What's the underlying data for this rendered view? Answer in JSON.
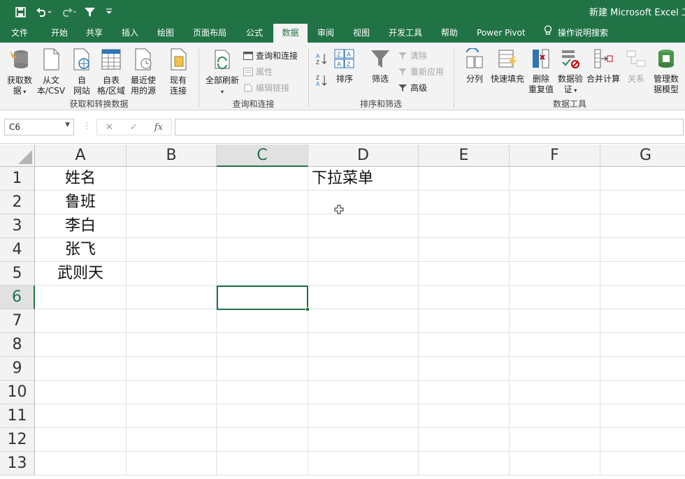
{
  "titlebar": {
    "title": "新建 Microsoft Excel 工作表",
    "save_icon": "save-icon",
    "undo_icon": "undo-icon",
    "redo_icon": "redo-icon",
    "filter_icon": "filter-icon",
    "customize_icon": "customize-quick-access-icon",
    "bg": "#217346"
  },
  "tabs": [
    {
      "label": "文件"
    },
    {
      "label": "开始"
    },
    {
      "label": "共享"
    },
    {
      "label": "插入"
    },
    {
      "label": "绘图"
    },
    {
      "label": "页面布局"
    },
    {
      "label": "公式"
    },
    {
      "label": "数据",
      "active": true
    },
    {
      "label": "审阅"
    },
    {
      "label": "视图"
    },
    {
      "label": "开发工具"
    },
    {
      "label": "帮助"
    },
    {
      "label": "Power Pivot"
    },
    {
      "label": "操作说明搜索",
      "icon": "lightbulb-icon"
    }
  ],
  "ribbon": {
    "get_transform": {
      "group_label": "获取和转换数据",
      "get_data": "获取数\n据",
      "from_text": "从文\n本/CSV",
      "from_web": "自\n网站",
      "from_table": "自表\n格/区域",
      "recent_sources": "最近使\n用的源",
      "existing": "现有\n连接"
    },
    "queries": {
      "group_label": "查询和连接",
      "refresh_all": "全部刷新",
      "queries_conn": "查询和连接",
      "properties": "属性",
      "edit_links": "编辑链接"
    },
    "sort_filter": {
      "group_label": "排序和筛选",
      "sort": "排序",
      "filter": "筛选",
      "clear": "清除",
      "reapply": "重新应用",
      "advanced": "高级"
    },
    "data_tools": {
      "group_label": "数据工具",
      "text_to_columns": "分列",
      "flash_fill": "快速填充",
      "remove_dup": "删除\n重复值",
      "validation": "数据验\n证",
      "consolidate": "合并计算",
      "relations": "关系",
      "data_model": "管理数\n据模型"
    }
  },
  "formula_bar": {
    "name_box": "C6",
    "cancel": "✕",
    "enter": "✓",
    "fx": "fx",
    "content": ""
  },
  "grid": {
    "columns": [
      "A",
      "B",
      "C",
      "D",
      "E",
      "F",
      "G"
    ],
    "selected_col": "C",
    "rows": [
      "1",
      "2",
      "3",
      "4",
      "5",
      "6",
      "7",
      "8",
      "9",
      "10",
      "11",
      "12",
      "13"
    ],
    "selected_row": "6",
    "cells": {
      "A1": "姓名",
      "A2": "鲁班",
      "A3": "李白",
      "A4": "张飞",
      "A5": "武则天",
      "D1": "下拉菜单"
    },
    "active_cell": "C6"
  }
}
